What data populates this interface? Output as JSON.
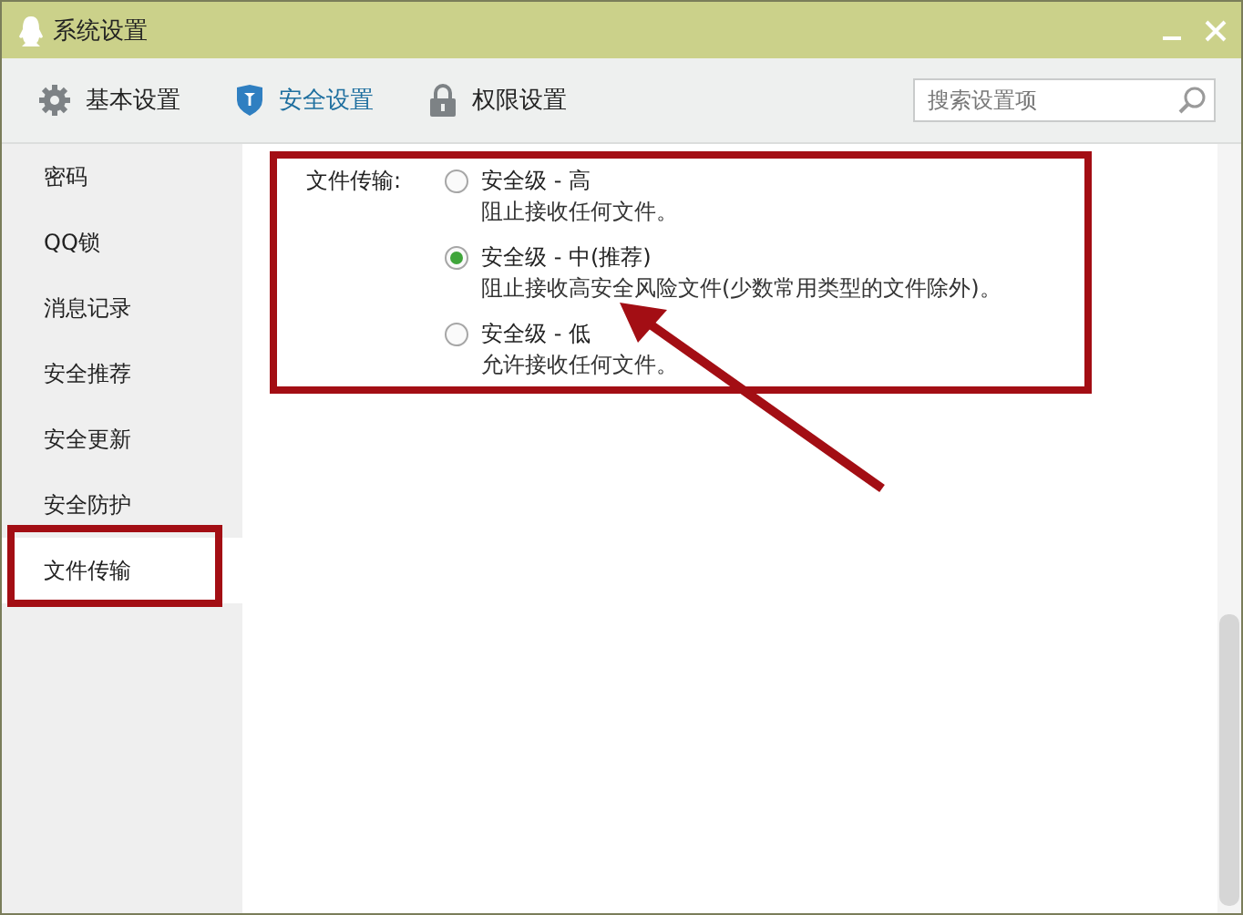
{
  "window": {
    "title": "系统设置"
  },
  "tabs": [
    {
      "label": "基本设置",
      "selected": false
    },
    {
      "label": "安全设置",
      "selected": true
    },
    {
      "label": "权限设置",
      "selected": false
    }
  ],
  "search": {
    "placeholder": "搜索设置项"
  },
  "sidebar": {
    "items": [
      {
        "label": "密码",
        "selected": false
      },
      {
        "label": "QQ锁",
        "selected": false
      },
      {
        "label": "消息记录",
        "selected": false
      },
      {
        "label": "安全推荐",
        "selected": false
      },
      {
        "label": "安全更新",
        "selected": false
      },
      {
        "label": "安全防护",
        "selected": false
      },
      {
        "label": "文件传输",
        "selected": true
      }
    ]
  },
  "file_transfer": {
    "label": "文件传输:",
    "options": [
      {
        "label": "安全级 - 高",
        "description": "阻止接收任何文件。",
        "selected": false
      },
      {
        "label": "安全级 - 中(推荐)",
        "description": "阻止接收高安全风险文件(少数常用类型的文件除外)。",
        "selected": true
      },
      {
        "label": "安全级 - 低",
        "description": "允许接收任何文件。",
        "selected": false
      }
    ]
  }
}
